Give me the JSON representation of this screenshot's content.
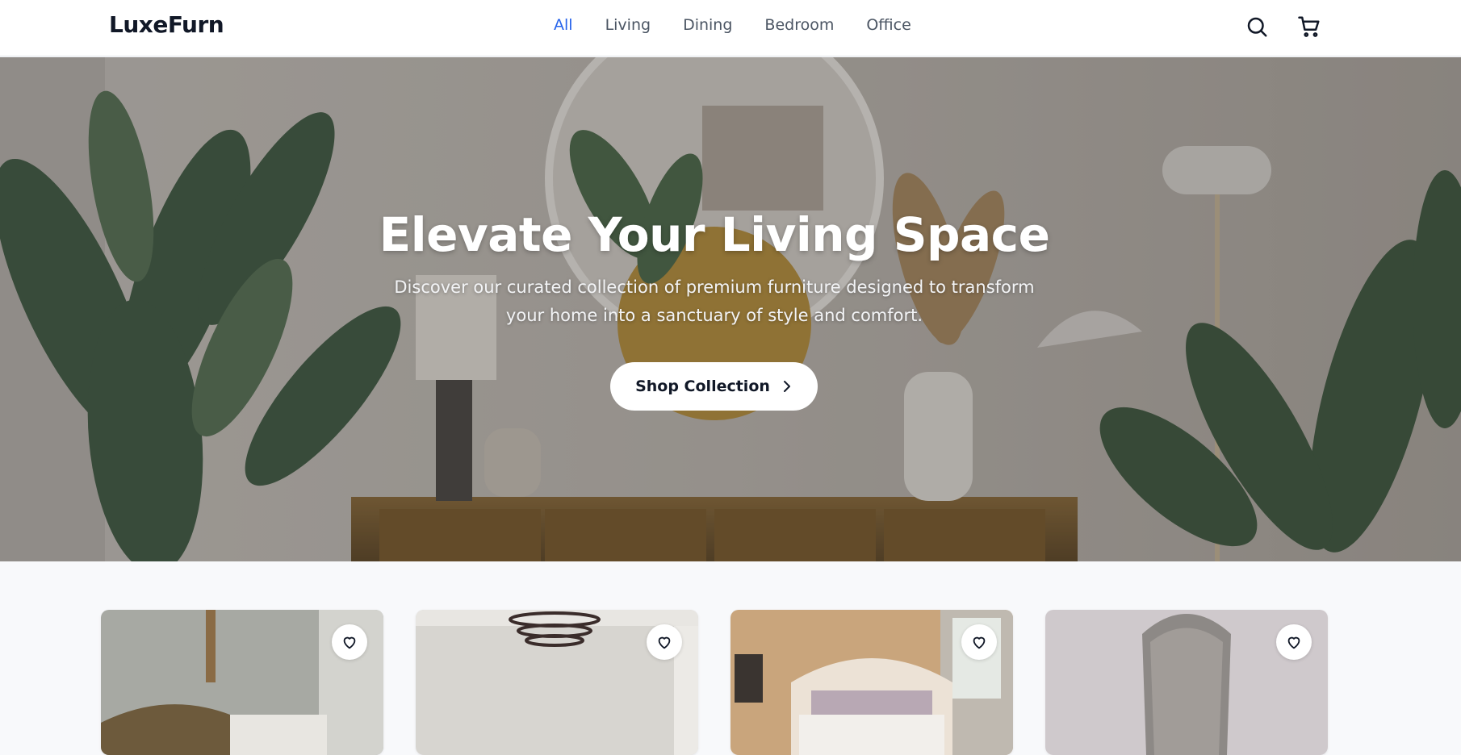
{
  "brand": {
    "name": "LuxeFurn"
  },
  "nav": {
    "items": [
      {
        "label": "All",
        "active": true
      },
      {
        "label": "Living",
        "active": false
      },
      {
        "label": "Dining",
        "active": false
      },
      {
        "label": "Bedroom",
        "active": false
      },
      {
        "label": "Office",
        "active": false
      }
    ],
    "icons": [
      "search-icon",
      "cart-icon"
    ]
  },
  "hero": {
    "title": "Elevate Your Living Space",
    "subtitle": "Discover our curated collection of premium furniture designed to transform your home into a sanctuary of style and comfort.",
    "cta_label": "Shop Collection"
  },
  "products": [
    {
      "image": "living-room-photo",
      "favorite_icon": "heart-icon"
    },
    {
      "image": "dining-room-photo",
      "favorite_icon": "heart-icon"
    },
    {
      "image": "bedroom-photo",
      "favorite_icon": "heart-icon"
    },
    {
      "image": "office-chair-photo",
      "favorite_icon": "heart-icon"
    }
  ],
  "colors": {
    "accent": "#2563eb",
    "text": "#111827",
    "muted": "#4b5563",
    "page_bg": "#f8f9fb"
  }
}
